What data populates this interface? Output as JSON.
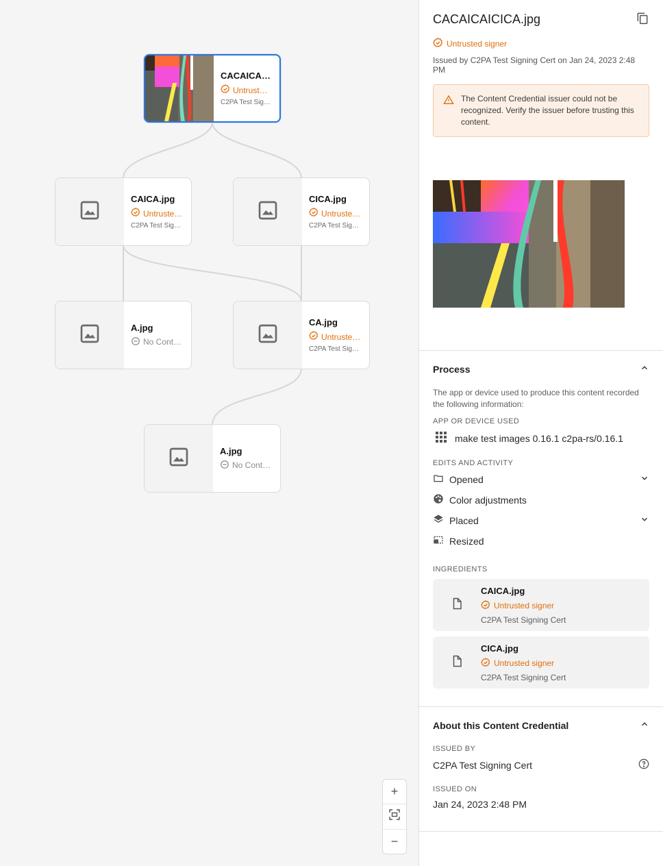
{
  "graph": {
    "root": {
      "name": "CACAICAI…",
      "status": "Untrust…",
      "signer": "C2PA Test Sig…"
    },
    "caica": {
      "name": "CAICA.jpg",
      "status": "Untruste…",
      "signer": "C2PA Test Sig…"
    },
    "cica": {
      "name": "CICA.jpg",
      "status": "Untruste…",
      "signer": "C2PA Test Sig…"
    },
    "a1": {
      "name": "A.jpg",
      "status": "No Cont…"
    },
    "ca": {
      "name": "CA.jpg",
      "status": "Untruste…",
      "signer": "C2PA Test Sig…"
    },
    "a2": {
      "name": "A.jpg",
      "status": "No Cont…"
    }
  },
  "zoom": {
    "in": "+",
    "fit": "⛶",
    "out": "−"
  },
  "panel": {
    "title": "CACAICAICICA.jpg",
    "status": "Untrusted signer",
    "issued_line": "Issued by C2PA Test Signing Cert on Jan 24, 2023 2:48 PM",
    "alert": "The Content Credential issuer could not be recognized. Verify the issuer before trusting this content.",
    "process": {
      "heading": "Process",
      "description": "The app or device used to produce this content recorded the following information:",
      "app_caption": "APP OR DEVICE USED",
      "app_value": "make test images 0.16.1 c2pa-rs/0.16.1",
      "edits_caption": "EDITS AND ACTIVITY",
      "edits": [
        "Opened",
        "Color adjustments",
        "Placed",
        "Resized"
      ],
      "ingredients_caption": "INGREDIENTS",
      "ingredients": [
        {
          "name": "CAICA.jpg",
          "status": "Untrusted signer",
          "signer": "C2PA Test Signing Cert"
        },
        {
          "name": "CICA.jpg",
          "status": "Untrusted signer",
          "signer": "C2PA Test Signing Cert"
        }
      ]
    },
    "about": {
      "heading": "About this Content Credential",
      "issued_by_caption": "ISSUED BY",
      "issued_by": "C2PA Test Signing Cert",
      "issued_on_caption": "ISSUED ON",
      "issued_on": "Jan 24, 2023 2:48 PM"
    }
  },
  "colors": {
    "accent": "#2d74da",
    "warning": "#e06f0b"
  },
  "icons": [
    "image-placeholder-icon",
    "untrusted-badge-icon",
    "no-credential-icon",
    "copy-icon",
    "warning-icon",
    "chevron-up-icon",
    "chevron-down-icon",
    "apps-grid-icon",
    "folder-icon",
    "palette-icon",
    "layers-icon",
    "resize-icon",
    "file-icon",
    "help-icon"
  ]
}
